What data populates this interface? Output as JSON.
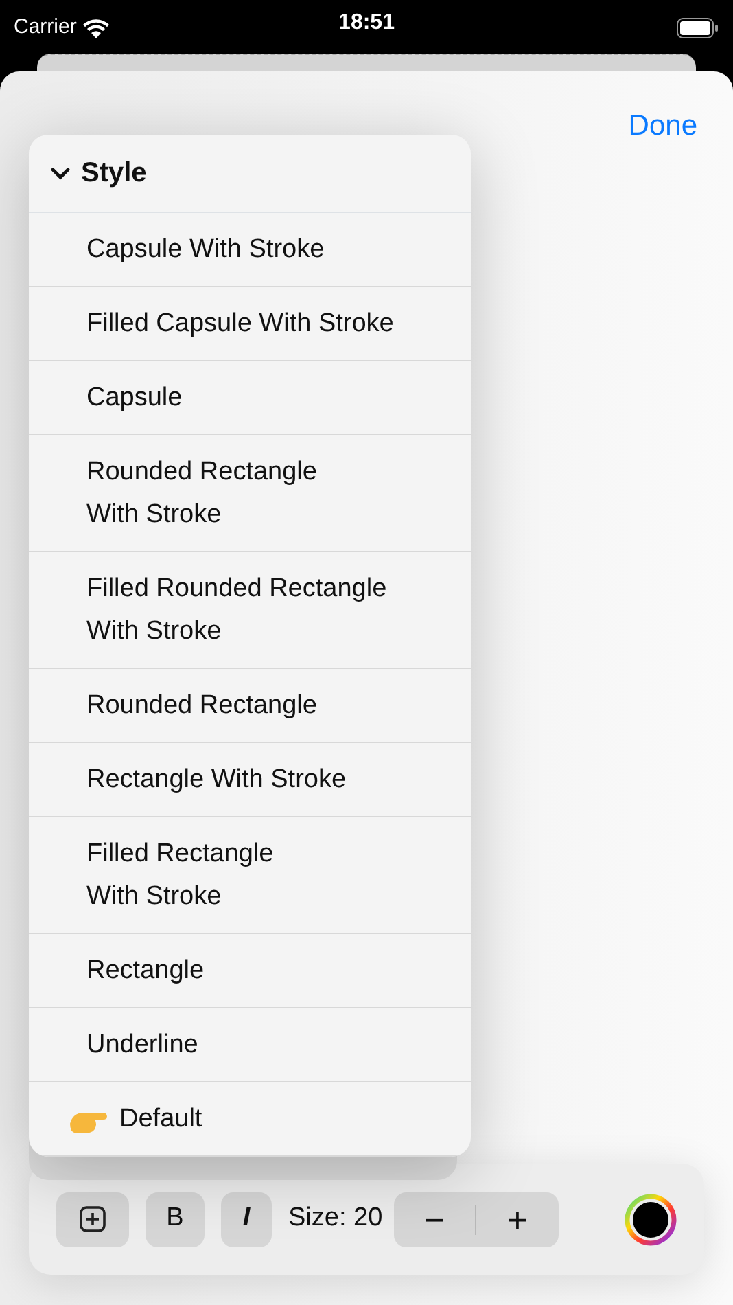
{
  "status_bar": {
    "carrier": "Carrier",
    "time": "18:51"
  },
  "done_button": "Done",
  "style_menu": {
    "title": "Style",
    "expanded": true,
    "items": [
      {
        "label": "Capsule With Stroke",
        "kind": "plain"
      },
      {
        "label": "Filled Capsule With Stroke",
        "kind": "plain"
      },
      {
        "label": "Capsule",
        "kind": "plain"
      },
      {
        "label": "Rounded Rectangle\nWith Stroke",
        "kind": "plain"
      },
      {
        "label": "Filled Rounded Rectangle\nWith Stroke",
        "kind": "plain"
      },
      {
        "label": "Rounded Rectangle",
        "kind": "plain"
      },
      {
        "label": "Rectangle With Stroke",
        "kind": "plain"
      },
      {
        "label": "Filled Rectangle\nWith Stroke",
        "kind": "plain"
      },
      {
        "label": "Rectangle",
        "kind": "plain"
      },
      {
        "label": "Underline",
        "kind": "plain"
      },
      {
        "label": "Default",
        "kind": "emoji"
      }
    ]
  },
  "toolbar": {
    "bold": "B",
    "italic": "I",
    "size_label": "Size: 20",
    "minus": "−",
    "plus": "+"
  }
}
